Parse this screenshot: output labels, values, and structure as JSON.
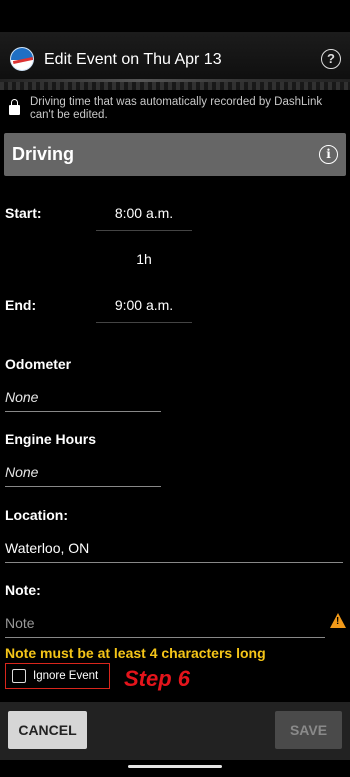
{
  "app_bar": {
    "title": "Edit Event on Thu Apr 13",
    "logo_icon": "dashlink-logo",
    "help_icon": "question-circle-icon"
  },
  "notice": {
    "text": "Driving time that was automatically recorded by DashLink can't be edited.",
    "icon": "lock-icon"
  },
  "section": {
    "title": "Driving",
    "info_icon": "info-icon"
  },
  "start": {
    "label": "Start:",
    "value": "8:00 a.m."
  },
  "duration": "1h",
  "end": {
    "label": "End:",
    "value": "9:00 a.m."
  },
  "odometer": {
    "label": "Odometer",
    "value": "None"
  },
  "engine_hours": {
    "label": "Engine Hours",
    "value": "None"
  },
  "location": {
    "label": "Location:",
    "value": "Waterloo, ON"
  },
  "note": {
    "label": "Note:",
    "placeholder": "Note",
    "value": ""
  },
  "error": {
    "text": "Note must be at least 4 characters long",
    "color": "#f5c518"
  },
  "ignore_event": {
    "label": "Ignore Event",
    "checked": false
  },
  "annotation": {
    "text": "Step 6",
    "color": "#e4141b"
  },
  "actions": {
    "cancel_label": "CANCEL",
    "save_label": "SAVE"
  },
  "colors": {
    "header_bg": "#666666",
    "warning": "#f29a1a",
    "highlight_border": "#d9261c"
  }
}
